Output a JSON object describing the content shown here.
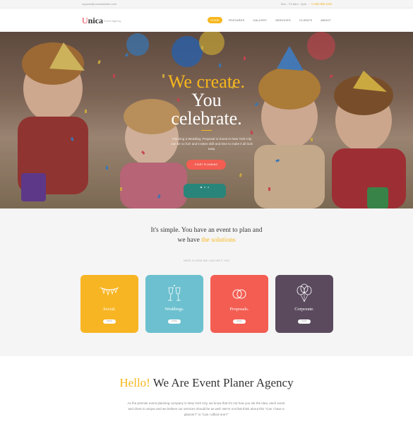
{
  "topbar": {
    "email": "support@unicawebsite.com",
    "contact": "Mon - Fri 8am - 6pm",
    "phone": "+1 800 555 1234"
  },
  "header": {
    "logo_mark": "U",
    "logo_text": "nica",
    "logo_sub": "Event Agency",
    "nav": [
      {
        "label": "HOME",
        "active": true
      },
      {
        "label": "FEATURES",
        "active": false
      },
      {
        "label": "GALLERY",
        "active": false
      },
      {
        "label": "SERVICES",
        "active": false
      },
      {
        "label": "CLIENTS",
        "active": false
      },
      {
        "label": "ABOUT",
        "active": false
      }
    ]
  },
  "hero": {
    "title_line1": "We create.",
    "title_line2": "You",
    "title_line3": "celebrate.",
    "description": "Planning a Wedding, Proposal or Event in New York City can be so fun! and it takes skill and time to make it all look easy.",
    "button": "START PLANNING",
    "slides": 3,
    "active_slide": 0
  },
  "solutions": {
    "heading_line1": "It's simple. You have an event to plan and",
    "heading_line2_prefix": "we have",
    "heading_line2_accent": "the solutions",
    "subheading": "HERE IS HOW WE CAN HELP YOU",
    "cards": [
      {
        "title": "Social.",
        "button": "MORE",
        "color": "#f8b523",
        "icon": "bunting-icon"
      },
      {
        "title": "Weddings.",
        "button": "MORE",
        "color": "#6cc0cf",
        "icon": "wedding-glasses-icon"
      },
      {
        "title": "Proposals.",
        "button": "MORE",
        "color": "#f35d52",
        "icon": "rings-icon"
      },
      {
        "title": "Corporate.",
        "button": "MORE",
        "color": "#5b4a5e",
        "icon": "balloons-icon"
      }
    ]
  },
  "about": {
    "title_accent": "Hello!",
    "title_rest": "We Are Event Planer Agency",
    "text": "As the premier event planning company in New York City, we know that it's not how you stir the idea, each event and client is unique and we believe our services should be as well. We're not that think about this \"Can I have a planner?\" is \"Can I afford one?\""
  },
  "colors": {
    "accent": "#f7b71d",
    "brand_red": "#e6424a",
    "button_red": "#f35d52"
  }
}
